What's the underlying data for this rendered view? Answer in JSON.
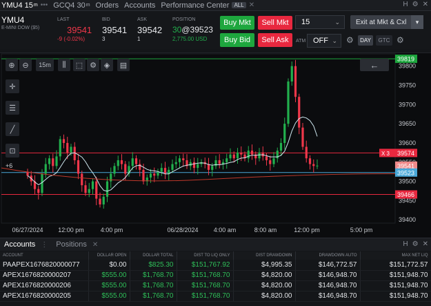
{
  "tabs": [
    {
      "label": "YMU4 15",
      "suffix": "m",
      "active": true
    },
    {
      "label": "GCQ4 30",
      "suffix": "m",
      "active": false
    },
    {
      "label": "Orders",
      "suffix": "",
      "active": false
    },
    {
      "label": "Accounts",
      "suffix": "",
      "active": false
    },
    {
      "label": "Performance Center",
      "suffix": "",
      "active": false,
      "badge": "ALL"
    }
  ],
  "instrument": {
    "symbol": "YMU4",
    "description": "E-MINI DOW ($5)"
  },
  "quote": {
    "last_label": "LAST",
    "last": "39541",
    "last_change": "-9 (-0.02%)",
    "bid_label": "BID",
    "bid": "39541",
    "bid_size": "3",
    "ask_label": "ASK",
    "ask": "39542",
    "ask_size": "1",
    "position_label": "POSITION",
    "position_qty": "30",
    "position_price": "@39523",
    "position_pnl": "2,775.00 USD"
  },
  "buttons": {
    "buy_mkt": "Buy Mkt",
    "sell_mkt": "Sell Mkt",
    "buy_bid": "Buy Bid",
    "sell_ask": "Sell Ask",
    "exit": "Exit at Mkt & Cxl",
    "atm_label": "ATM",
    "atm_value": "OFF",
    "day": "DAY",
    "gtc": "GTC"
  },
  "quantity": "15",
  "chart_toolbar": {
    "interval": "15m"
  },
  "chart_data": {
    "type": "candlestick",
    "y_ticks": [
      39800,
      39750,
      39700,
      39650,
      39600,
      39550,
      39500,
      39450,
      39400
    ],
    "ylim": [
      39395,
      39830
    ],
    "x_ticks": [
      "06/27/2024",
      "12:00 pm",
      "4:00 pm",
      "06/28/2024",
      "4:00 am",
      "8:00 am",
      "12:00 pm",
      "5:00 pm"
    ],
    "price_labels": [
      {
        "value": 39819,
        "text": "39819",
        "color": "#1ea73e"
      },
      {
        "value": 39574,
        "text": "39574",
        "color": "#e8283f"
      },
      {
        "value": 39541,
        "text": "39541",
        "color": "#f08a8a"
      },
      {
        "value": 39523,
        "text": "39523",
        "color": "#4aa8d8"
      },
      {
        "value": 39466,
        "text": "39466",
        "color": "#e8283f"
      }
    ],
    "order_marker": "X 3",
    "position_marker": "+6",
    "closes": [
      39515,
      39500,
      39480,
      39470,
      39520,
      39545,
      39560,
      39540,
      39565,
      39610,
      39600,
      39575,
      39590,
      39555,
      39520,
      39490,
      39470,
      39480,
      39500,
      39455,
      39440,
      39460,
      39500,
      39520,
      39540,
      39555,
      39545,
      39520,
      39540,
      39560,
      39545,
      39530,
      39500,
      39510,
      39520,
      39515,
      39525,
      39535,
      39520,
      39530,
      39545,
      39550,
      39560,
      39555,
      39540,
      39550,
      39535,
      39545,
      39550,
      39545,
      39530,
      39540,
      39555,
      39545,
      39550,
      39560,
      39570,
      39560,
      39575,
      39570,
      39560,
      39580,
      39570,
      39560,
      39575,
      39565,
      39555,
      39545,
      39560,
      39580,
      39600,
      39650,
      39760,
      39800,
      39720,
      39640,
      39590,
      39560,
      39545,
      39540,
      39541
    ]
  },
  "accounts_panel": {
    "tabs": [
      "Accounts",
      "Positions"
    ],
    "columns": [
      "ACCOUNT",
      "DOLLAR OPEN",
      "DOLLAR TOTAL",
      "DIST TO LIQ ONLY",
      "DIST DRAWDOWN",
      "DRAWDOWN AUTO",
      "MAX NET LIQ"
    ],
    "rows": [
      [
        "PAAPEX1676820000077",
        "$0.00",
        "$825.30",
        "$151,767.92",
        "$4,995.35",
        "$146,772.57",
        "$151,772.57"
      ],
      [
        "APEX1676820000207",
        "$555.00",
        "$1,768.70",
        "$151,768.70",
        "$4,820.00",
        "$146,948.70",
        "$151,948.70"
      ],
      [
        "APEX1676820000206",
        "$555.00",
        "$1,768.70",
        "$151,768.70",
        "$4,820.00",
        "$146,948.70",
        "$151,948.70"
      ],
      [
        "APEX1676820000205",
        "$555.00",
        "$1,768.70",
        "$151,768.70",
        "$4,820.00",
        "$146,948.70",
        "$151,948.70"
      ]
    ]
  },
  "colors": {
    "up": "#22b04d",
    "down": "#f0374a",
    "ma": "#cfe8f0",
    "ma2": "#c0392b"
  }
}
